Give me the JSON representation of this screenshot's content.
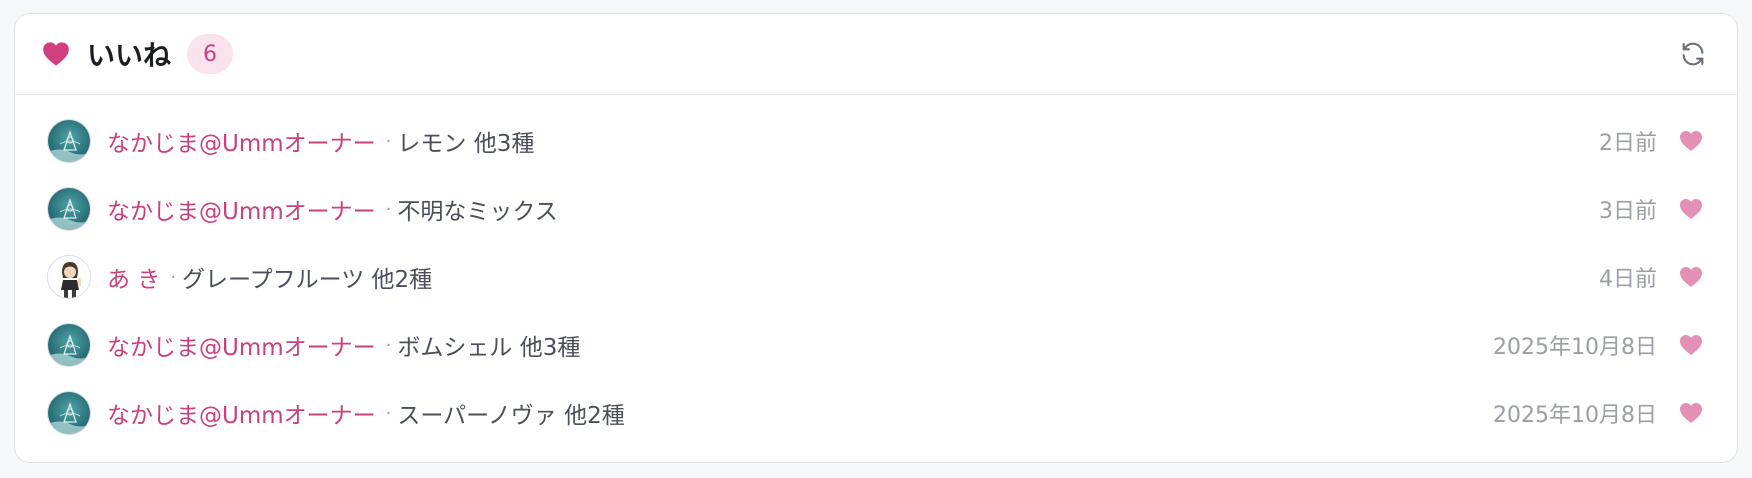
{
  "header": {
    "title": "いいね",
    "count": "6",
    "heart_icon": "heart-icon",
    "refresh_icon": "refresh-icon"
  },
  "colors": {
    "accent": "#c8417d",
    "heart_header": "#d0407e",
    "heart_row": "#e48fb6"
  },
  "likes": [
    {
      "user": "なかじま@Ummオーナー",
      "item": "レモン 他3種",
      "time": "2日前",
      "avatar": "ocean-avatar"
    },
    {
      "user": "なかじま@Ummオーナー",
      "item": "不明なミックス",
      "time": "3日前",
      "avatar": "ocean-avatar"
    },
    {
      "user": "あ き",
      "item": "グレープフルーツ 他2種",
      "time": "4日前",
      "avatar": "character-avatar"
    },
    {
      "user": "なかじま@Ummオーナー",
      "item": "ボムシェル 他3種",
      "time": "2025年10月8日",
      "avatar": "ocean-avatar"
    },
    {
      "user": "なかじま@Ummオーナー",
      "item": "スーパーノヴァ 他2種",
      "time": "2025年10月8日",
      "avatar": "ocean-avatar"
    }
  ]
}
